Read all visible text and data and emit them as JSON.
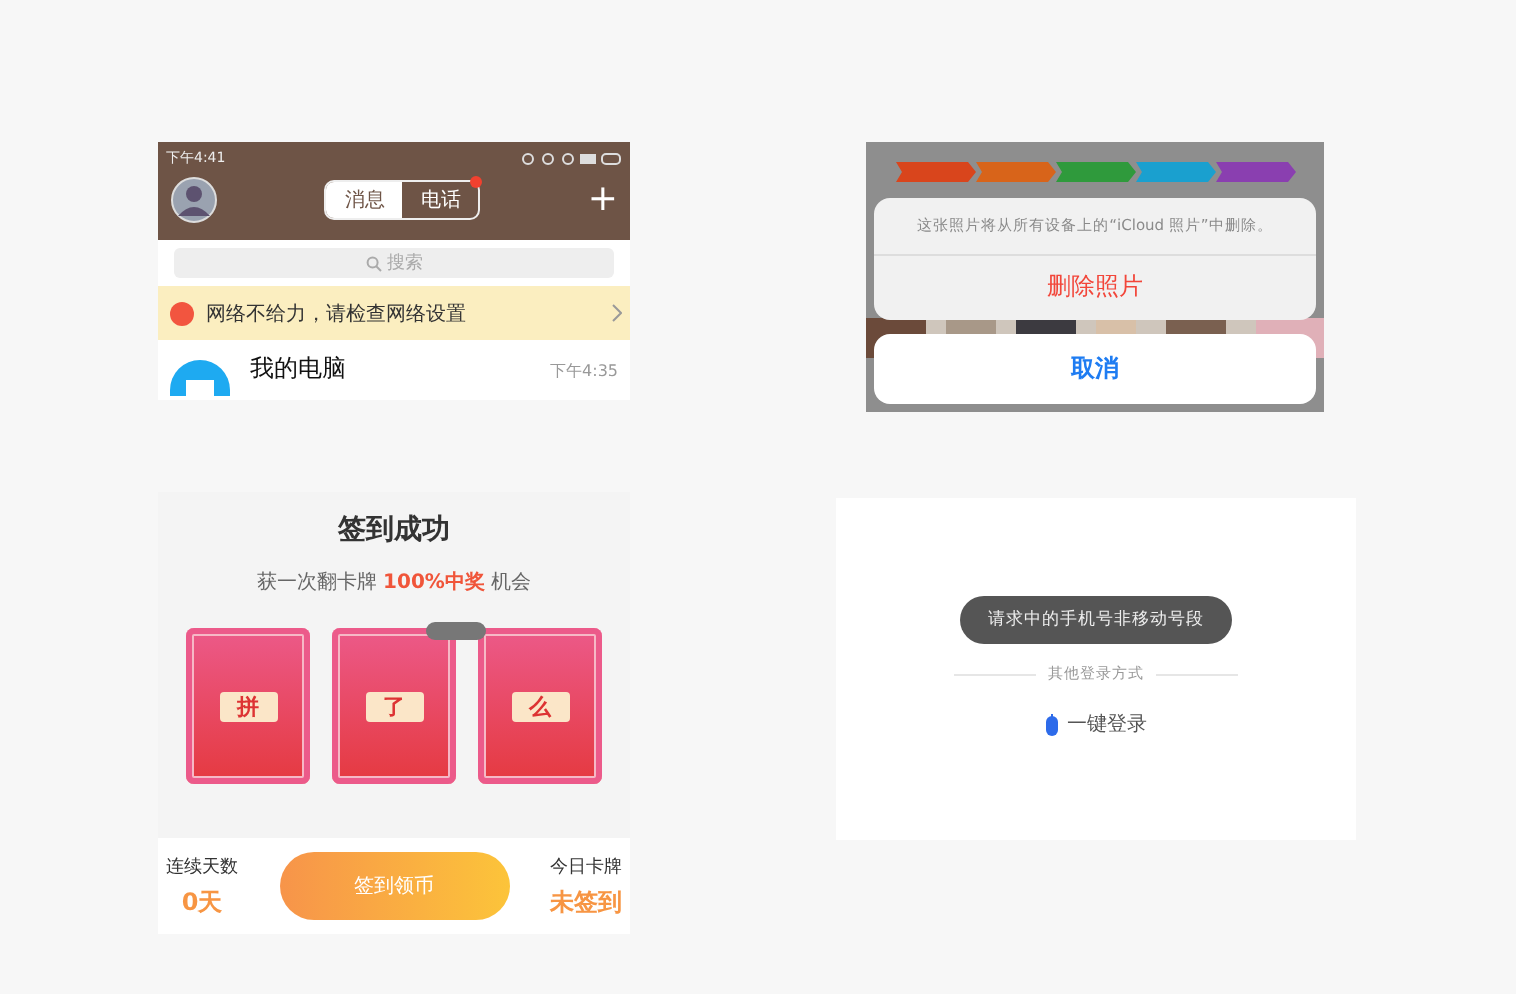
{
  "chat_screen": {
    "status_time": "下午4:41",
    "tabs": [
      {
        "label": "消息",
        "selected": true,
        "badge": false
      },
      {
        "label": "电话",
        "selected": false,
        "badge": true
      }
    ],
    "add_icon": "+",
    "search_placeholder": "搜索",
    "warning": "网络不给力，请检查网络设置",
    "conversation": {
      "name": "我的电脑",
      "time": "下午4:35"
    }
  },
  "delete_sheet": {
    "steps": [
      {
        "color": "#d9451c"
      },
      {
        "color": "#d8641a"
      },
      {
        "color": "#2f9a3c"
      },
      {
        "color": "#1aa0cf"
      },
      {
        "color": "#8a3fb0"
      }
    ],
    "message": "这张照片将从所有设备上的“iCloud 照片”中删除。",
    "destructive_action": "删除照片",
    "cancel": "取消"
  },
  "checkin_screen": {
    "title": "签到成功",
    "subtitle": "获一次翻卡牌 **100%中奖** 机会",
    "cards": [
      {
        "glyph": "拼"
      },
      {
        "glyph": "了"
      },
      {
        "glyph": "么"
      }
    ],
    "streak_label": "连续天数",
    "streak_value": "0天",
    "checkin_button": "签到领币",
    "today_label": "今日卡牌",
    "today_value": "未签到"
  },
  "login_screen": {
    "toast": "请求中的手机号非移动号段",
    "divider_label": "其他登录方式",
    "one_tap_login": "一键登录"
  }
}
